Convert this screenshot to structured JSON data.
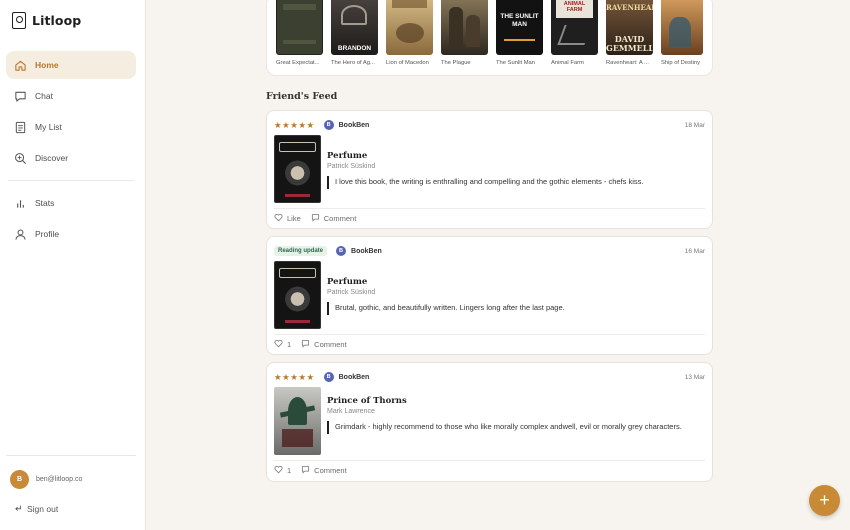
{
  "app": {
    "name": "Litloop"
  },
  "sidebar": {
    "items": [
      {
        "label": "Home",
        "icon": "home-icon",
        "active": true
      },
      {
        "label": "Chat",
        "icon": "chat-icon",
        "active": false
      },
      {
        "label": "My List",
        "icon": "list-icon",
        "active": false
      },
      {
        "label": "Discover",
        "icon": "discover-icon",
        "active": false
      },
      {
        "label": "Stats",
        "icon": "stats-icon",
        "active": false
      },
      {
        "label": "Profile",
        "icon": "profile-icon",
        "active": false
      }
    ],
    "user": {
      "initial": "B",
      "email": "ben@litloop.co"
    },
    "sign_out": "Sign out"
  },
  "carousel": {
    "books": [
      {
        "title": "Great Expectat...",
        "cover_color": "#3b4030"
      },
      {
        "title": "The Hero of Ag...",
        "cover_color": "#2f2b28",
        "cover_text": "BRANDON"
      },
      {
        "title": "Lion of Macedon",
        "cover_color": "#c9a56a"
      },
      {
        "title": "The Plague",
        "cover_color": "#5e5240"
      },
      {
        "title": "The Sunlit Man",
        "cover_color": "#121212",
        "cover_text": "THE SUNLIT MAN"
      },
      {
        "title": "Animal Farm",
        "cover_color": "#1f1f1f",
        "cover_text": "ANIMAL FARM"
      },
      {
        "title": "Ravenheart: A ...",
        "cover_color": "#4a3a2c",
        "cover_text": "DAVID GEMMELL"
      },
      {
        "title": "Ship of Destiny",
        "cover_color": "#b77a3d"
      }
    ]
  },
  "feed": {
    "title": "Friend's Feed",
    "posts": [
      {
        "stars": "★★★★★",
        "badge": "",
        "user_initial": "B",
        "user": "BookBen",
        "date": "18 Mar",
        "book_title": "Perfume",
        "author": "Patrick Süskind",
        "text": "I love this book, the writing is enthralling and compelling and the gothic elements - chefs kiss.",
        "like_label": "Like",
        "comment_label": "Comment"
      },
      {
        "stars": "",
        "badge": "Reading update",
        "user_initial": "B",
        "user": "BookBen",
        "date": "16 Mar",
        "book_title": "Perfume",
        "author": "Patrick Süskind",
        "text": "Brutal, gothic, and beautifully written. Lingers long after the last page.",
        "like_label": "1",
        "comment_label": "Comment"
      },
      {
        "stars": "★★★★★",
        "badge": "",
        "user_initial": "B",
        "user": "BookBen",
        "date": "13 Mar",
        "book_title": "Prince of Thorns",
        "author": "Mark Lawrence",
        "text": "Grimdark - highly recommend to those who like morally complex andwell, evil or morally grey characters.",
        "like_label": "1",
        "comment_label": "Comment"
      }
    ]
  },
  "fab": {
    "label": "+"
  },
  "colors": {
    "accent": "#c88a36",
    "active_bg": "#f5ede0",
    "page_bg": "#f7f4ef"
  }
}
